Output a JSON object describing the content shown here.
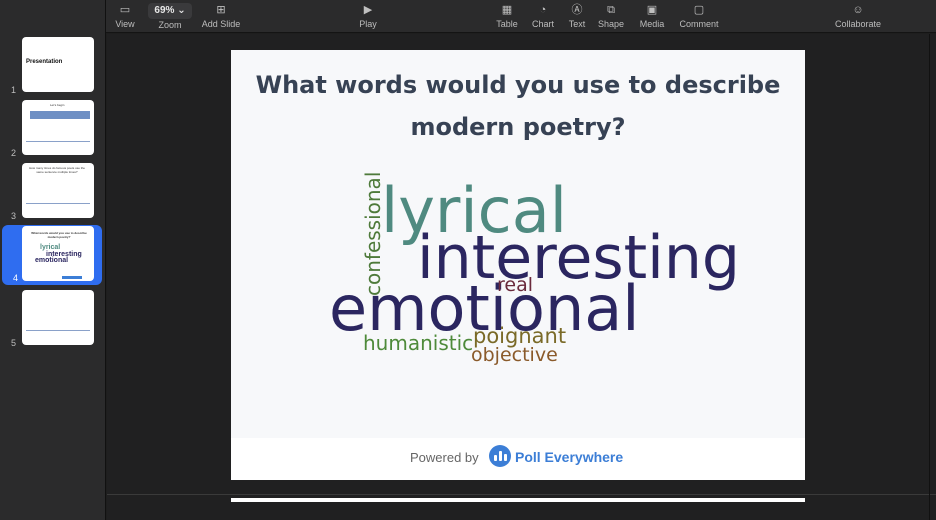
{
  "toolbar": {
    "view": "View",
    "zoom_value": "69%",
    "zoom": "Zoom",
    "add_slide": "Add Slide",
    "play": "Play",
    "table": "Table",
    "chart": "Chart",
    "text": "Text",
    "shape": "Shape",
    "media": "Media",
    "comment": "Comment",
    "collaborate": "Collaborate"
  },
  "sidebar": {
    "slides": [
      {
        "number": "1",
        "title": "Presentation"
      },
      {
        "number": "2",
        "title": "Let's begin"
      },
      {
        "number": "3",
        "title": "How many times do famous poets use the same sentence multiple times?"
      },
      {
        "number": "4",
        "title": "What words would you use to describe modern poetry?"
      },
      {
        "number": "5",
        "title": ""
      }
    ],
    "selected": 4
  },
  "slide": {
    "title_line1": "What words would you use to describe",
    "title_line2": "modern poetry?",
    "words": [
      {
        "text": "lyrical",
        "color": "#4f8a80"
      },
      {
        "text": "interesting",
        "color": "#2b2660"
      },
      {
        "text": "emotional",
        "color": "#2b2660"
      },
      {
        "text": "confessional",
        "color": "#4e7a3a"
      },
      {
        "text": "real",
        "color": "#6a2a3c"
      },
      {
        "text": "poignant",
        "color": "#7a6a28"
      },
      {
        "text": "humanistic",
        "color": "#4e8a3a"
      },
      {
        "text": "objective",
        "color": "#8a5a2a"
      }
    ],
    "footer_powered": "Powered by",
    "footer_brand": "Poll Everywhere",
    "brand_color": "#3c7ed6"
  }
}
